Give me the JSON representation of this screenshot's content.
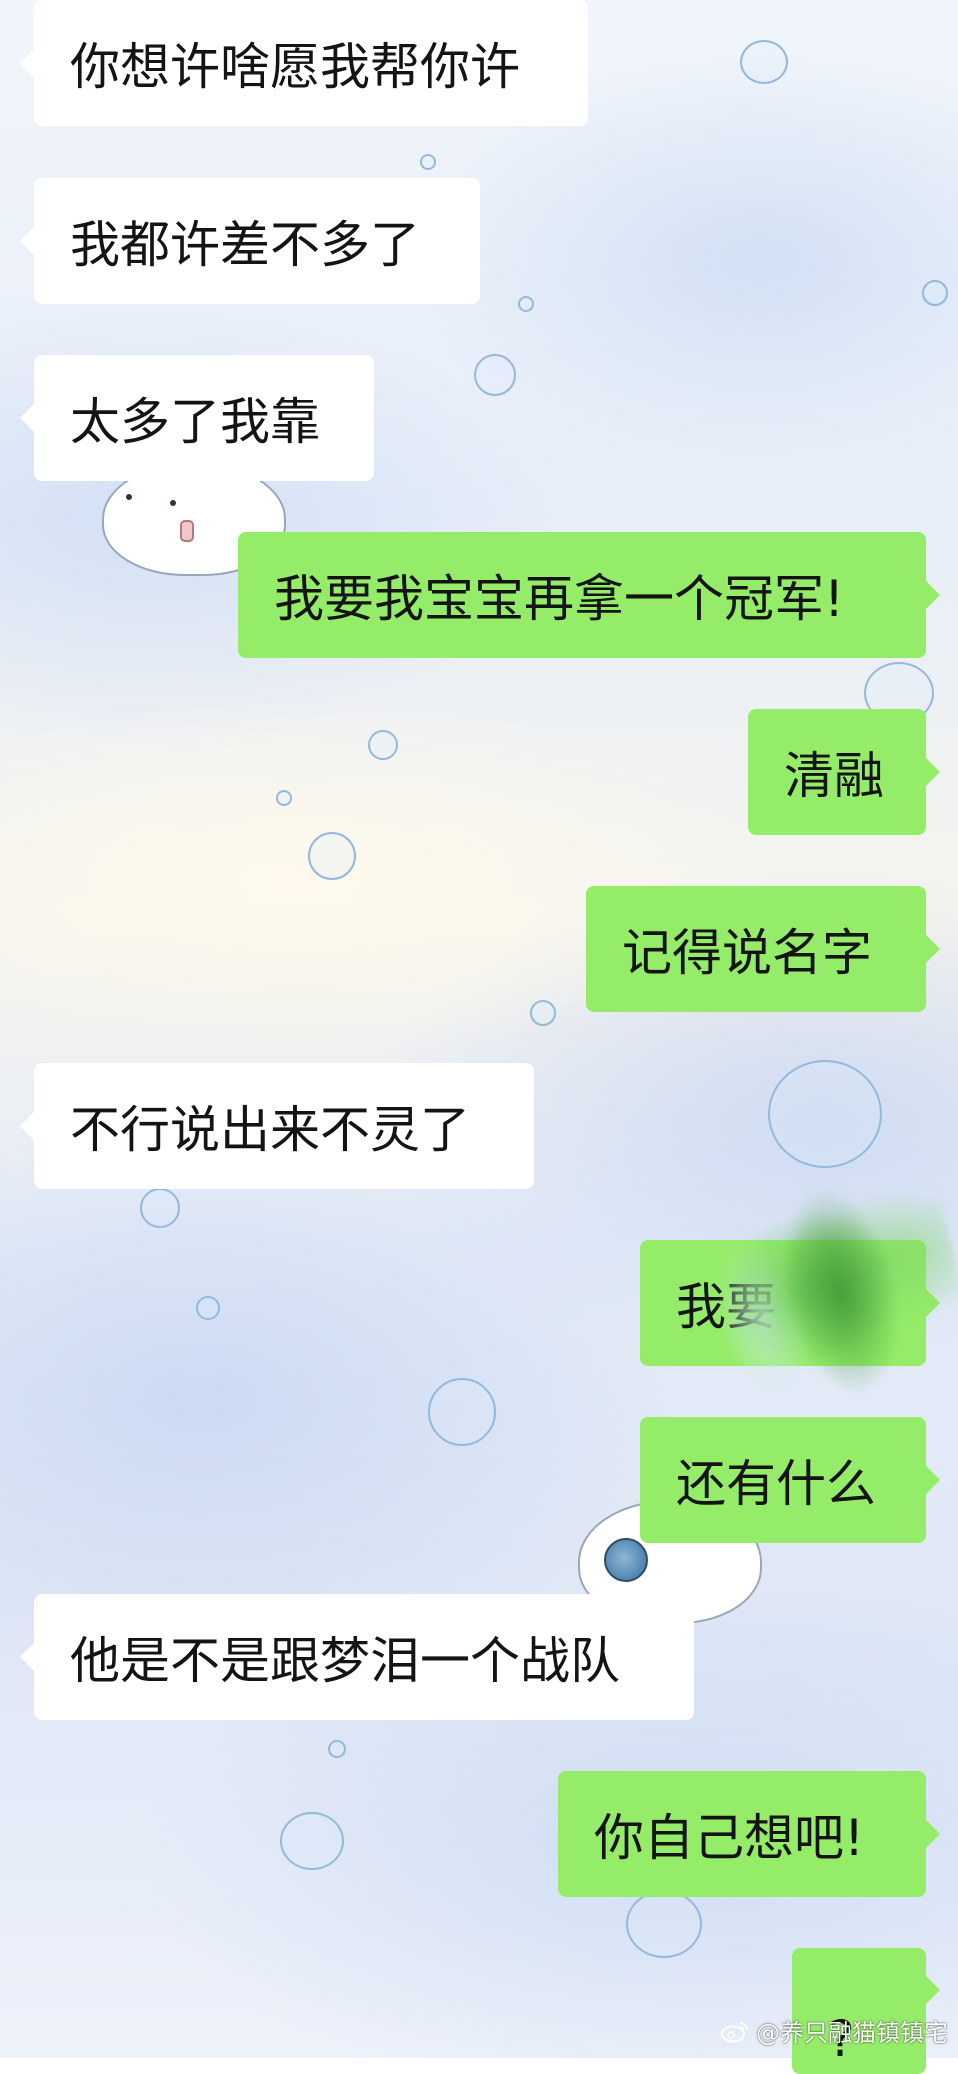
{
  "chat": {
    "messages": [
      {
        "side": "left",
        "text": "你想许啥愿我帮你许"
      },
      {
        "side": "left",
        "text": "我都许差不多了"
      },
      {
        "side": "left",
        "text": "太多了我靠"
      },
      {
        "side": "right",
        "text": "我要我宝宝再拿一个冠军!"
      },
      {
        "side": "right",
        "text": "清融"
      },
      {
        "side": "right",
        "text": "记得说名字"
      },
      {
        "side": "left",
        "text": "不行说出来不灵了"
      },
      {
        "side": "right",
        "text": "我要"
      },
      {
        "side": "right",
        "text": "还有什么"
      },
      {
        "side": "left",
        "text": "他是不是跟梦泪一个战队"
      },
      {
        "side": "right",
        "text": "你自己想吧!"
      },
      {
        "side": "right",
        "text": "?"
      }
    ]
  },
  "watermark": {
    "icon": "weibo-icon",
    "text": "@养只融猫镇镇宅"
  },
  "colors": {
    "incoming_bubble": "#ffffff",
    "outgoing_bubble": "#95ec69",
    "text": "#141414"
  }
}
